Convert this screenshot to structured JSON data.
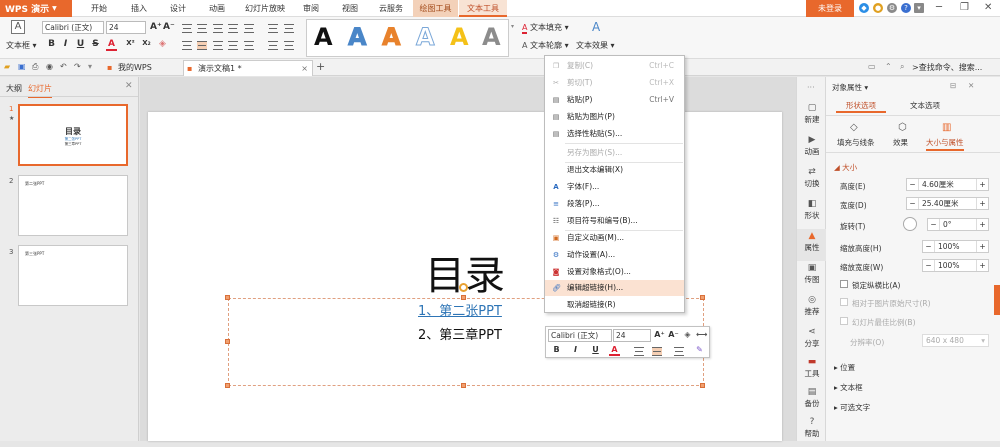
{
  "app": {
    "name": "WPS 演示"
  },
  "menubar": {
    "tabs": [
      "开始",
      "插入",
      "设计",
      "动画",
      "幻灯片放映",
      "审阅",
      "视图",
      "云服务"
    ],
    "context_tab": "绘图工具",
    "active_tab": "文本工具",
    "login": "未登录"
  },
  "ribbon": {
    "textbox_label": "文本框",
    "font_name": "Calibri (正文)",
    "font_size": "24",
    "text_fill": "文本填充",
    "text_outline": "文本轮廓",
    "text_effect": "文本效果",
    "style_glyph": "A",
    "style_colors": [
      "#111111",
      "#4a86c8",
      "#e8822c",
      "#7aa7d8",
      "#f4c118",
      "#8c8c8c"
    ]
  },
  "tabbar": {
    "tabs": [
      "我的WPS",
      "演示文稿1 *"
    ],
    "search": ">查找命令、搜索..."
  },
  "left_panel": {
    "tabs": [
      "大纲",
      "幻灯片"
    ],
    "slides": [
      {
        "num": "1",
        "title": "目录",
        "line1": "第二张PPT",
        "line2": "第三章PPT"
      },
      {
        "num": "2",
        "title": "第二张PPT"
      },
      {
        "num": "3",
        "title": "第三张PPT"
      }
    ]
  },
  "slide": {
    "title": "目录",
    "item1": "1、第二张PPT",
    "item2": "2、第三章PPT"
  },
  "context_menu": {
    "items": [
      {
        "icon": "copy-icon",
        "label": "复制(C)",
        "shortcut": "Ctrl+C",
        "disabled": true
      },
      {
        "icon": "cut-icon",
        "label": "剪切(T)",
        "shortcut": "Ctrl+X",
        "disabled": true
      },
      {
        "icon": "paste-icon",
        "label": "粘贴(P)",
        "shortcut": "Ctrl+V",
        "disabled": false
      },
      {
        "icon": "paste-as-image-icon",
        "label": "粘贴为图片(P)",
        "shortcut": "",
        "disabled": false
      },
      {
        "icon": "paste-special-icon",
        "label": "选择性粘贴(S)...",
        "shortcut": "",
        "disabled": false
      },
      {
        "icon": "",
        "label": "另存为图片(S)...",
        "shortcut": "",
        "disabled": true
      },
      {
        "icon": "",
        "label": "退出文本编辑(X)",
        "shortcut": "",
        "disabled": false
      },
      {
        "icon": "font-icon",
        "label": "字体(F)...",
        "shortcut": "",
        "disabled": false
      },
      {
        "icon": "paragraph-icon",
        "label": "段落(P)...",
        "shortcut": "",
        "disabled": false
      },
      {
        "icon": "list-icon",
        "label": "项目符号和编号(B)...",
        "shortcut": "",
        "disabled": false
      },
      {
        "icon": "custom-animation-icon",
        "label": "自定义动画(M)...",
        "shortcut": "",
        "disabled": false
      },
      {
        "icon": "action-icon",
        "label": "动作设置(A)...",
        "shortcut": "",
        "disabled": false
      },
      {
        "icon": "format-object-icon",
        "label": "设置对象格式(O)...",
        "shortcut": "",
        "disabled": false
      },
      {
        "icon": "hyperlink-icon",
        "label": "编辑超链接(H)...",
        "shortcut": "",
        "disabled": false
      },
      {
        "icon": "",
        "label": "取消超链接(R)",
        "shortcut": "",
        "disabled": false
      }
    ]
  },
  "mini_toolbar": {
    "font": "Calibri (正文)",
    "size": "24"
  },
  "icon_bar": [
    "新建",
    "动画",
    "切换",
    "形状",
    "属性",
    "传图",
    "推荐",
    "分享",
    "工具",
    "备份",
    "帮助"
  ],
  "right_panel": {
    "header": "对象属性",
    "tabs": [
      "形状选项",
      "文本选项"
    ],
    "subtabs": [
      "填充与线条",
      "效果",
      "大小与属性"
    ],
    "size_title": "大小",
    "height_label": "高度(E)",
    "height_value": "4.60厘米",
    "width_label": "宽度(D)",
    "width_value": "25.40厘米",
    "rotate_label": "旋转(T)",
    "rotate_value": "0°",
    "scale_h_label": "缩放高度(H)",
    "scale_h_value": "100%",
    "scale_w_label": "缩放宽度(W)",
    "scale_w_value": "100%",
    "lock_ratio": "锁定纵横比(A)",
    "relative_original": "相对于图片原始尺寸(R)",
    "best_scale": "幻灯片最佳比例(B)",
    "resolution_label": "分辨率(O)",
    "resolution_value": "640 x 480",
    "sections": [
      "位置",
      "文本框",
      "可选文字"
    ]
  },
  "colors": {
    "accent": "#e8682c",
    "link": "#2e75b6"
  }
}
